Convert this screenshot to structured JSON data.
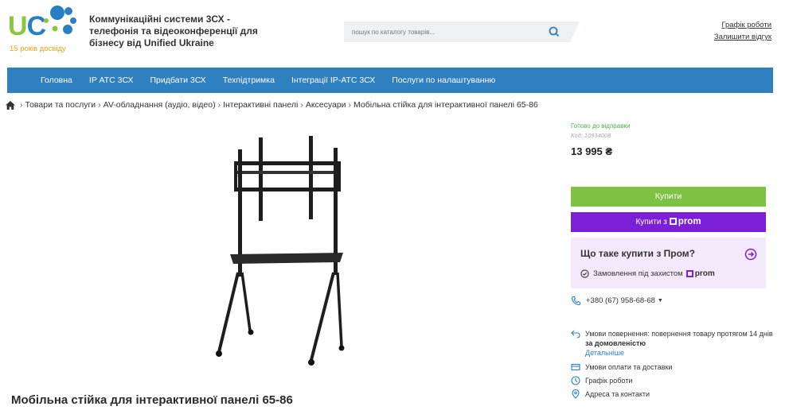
{
  "header": {
    "logo_years": "15 років досвіду",
    "company": "Коммунікаційні системи 3СХ - телефонія та відеоконференції для бізнесу від Unified Ukraine",
    "search_placeholder": "пошук по каталогу товарів...",
    "links": [
      "Графік роботи",
      "Залишити відгук"
    ]
  },
  "nav": {
    "items": [
      "Головна",
      "IP АТС 3СХ",
      "Придбати 3СХ",
      "Техпідтримка",
      "Інтеграції IP-АТС 3СХ",
      "Послуги по налаштуванню"
    ]
  },
  "breadcrumb": [
    "Товари та послуги",
    "AV-обладнання (аудіо, відео)",
    "Інтерактивні панелі",
    "Аксесуари",
    "Мобільна стійка для інтерактивної панелі 65-86"
  ],
  "product": {
    "title": "Мобільна стійка для інтерактивної панелі 65-86",
    "availability": "Готово до відправки",
    "code": "Код: 10934008",
    "price": "13 995 ₴",
    "buy_label": "Купити",
    "buy_prom_label": "Купити з",
    "prom_brand": "prom",
    "prom_question": "Що таке купити з Пром?",
    "prom_protection": "Замовлення під захистом",
    "phone": "+380 (67) 958-68-68",
    "return_label": "Умови повернення:",
    "return_text": "повернення товару протягом 14 днів",
    "return_bold": "за домовленістю",
    "return_more": "Детальніше",
    "payment_delivery": "Умови оплати та доставки",
    "schedule": "Графік роботи",
    "address": "Адреса та контакти"
  },
  "colors": {
    "nav": "#2f80c0",
    "buy": "#7dc242",
    "prom": "#7b20d8",
    "prom_card": "#f3e9fb"
  }
}
